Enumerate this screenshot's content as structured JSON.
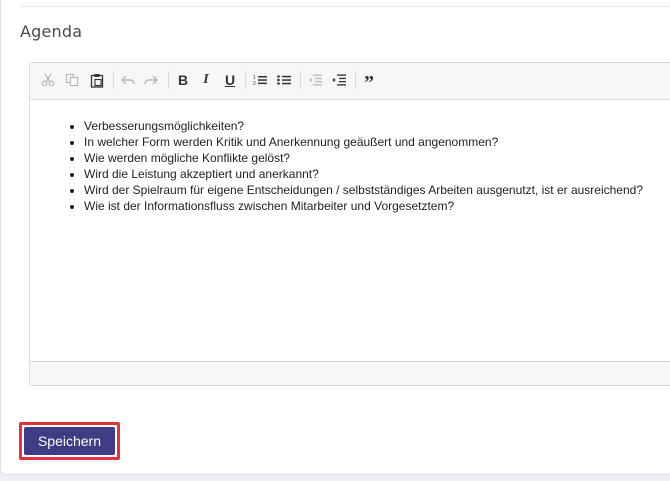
{
  "section": {
    "title": "Agenda"
  },
  "toolbar": {
    "buttons": [
      {
        "name": "cut-icon",
        "enabled": false
      },
      {
        "name": "copy-icon",
        "enabled": false
      },
      {
        "name": "paste-icon",
        "enabled": true
      },
      {
        "name": "undo-icon",
        "enabled": false
      },
      {
        "name": "redo-icon",
        "enabled": false
      },
      {
        "name": "bold-icon",
        "glyph": "B",
        "enabled": true
      },
      {
        "name": "italic-icon",
        "glyph": "I",
        "enabled": true
      },
      {
        "name": "underline-icon",
        "glyph": "U",
        "enabled": true
      },
      {
        "name": "numbered-list-icon",
        "enabled": true
      },
      {
        "name": "bulleted-list-icon",
        "enabled": true
      },
      {
        "name": "outdent-icon",
        "enabled": false
      },
      {
        "name": "indent-icon",
        "enabled": true
      },
      {
        "name": "blockquote-icon",
        "glyph": "”",
        "enabled": true
      }
    ]
  },
  "editor": {
    "items": [
      "Verbesserungsmöglichkeiten?",
      "In welcher Form werden Kritik und Anerkennung geäußert und angenommen?",
      "Wie werden mögliche Konflikte gelöst?",
      "Wird die Leistung akzeptiert und anerkannt?",
      "Wird der Spielraum für eigene Entscheidungen / selbstständiges Arbeiten ausgenutzt, ist er ausreichend?",
      "Wie ist der Informationsfluss zwischen Mitarbeiter und Vorgesetztem?"
    ]
  },
  "actions": {
    "save_label": "Speichern"
  },
  "colors": {
    "primary": "#3f3c86",
    "highlight": "#e0333c"
  }
}
